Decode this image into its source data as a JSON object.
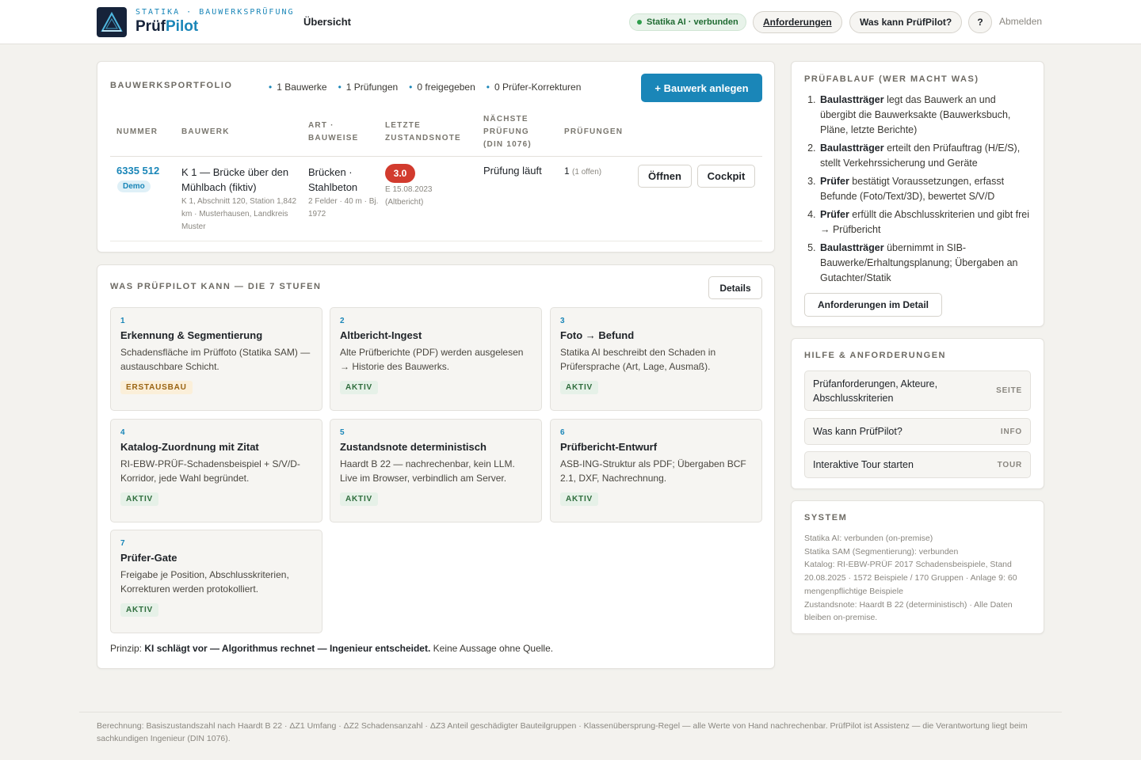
{
  "header": {
    "brand_sub": "STATIKA · BAUWERKSPRÜFUNG",
    "brand_name_a": "Prüf",
    "brand_name_b": "Pilot",
    "nav_overview": "Übersicht",
    "status": "Statika AI · verbunden",
    "requirements": "Anforderungen",
    "what_can": "Was kann PrüfPilot?",
    "help": "?",
    "logout": "Abmelden"
  },
  "portfolio": {
    "title": "Bauwerksportfolio",
    "stats": [
      "1 Bauwerke",
      "1 Prüfungen",
      "0 freigegeben",
      "0 Prüfer-Korrekturen"
    ],
    "add_button": "+ Bauwerk anlegen",
    "headers": {
      "nummer": "NUMMER",
      "bauwerk": "BAUWERK",
      "art_1": "ART ·",
      "art_2": "BAUWEISE",
      "note_1": "LETZTE",
      "note_2": "ZUSTANDSNOTE",
      "next_1": "NÄCHSTE",
      "next_2": "PRÜFUNG",
      "next_3": "(DIN 1076)",
      "pruef": "PRÜFUNGEN"
    },
    "row": {
      "number": "6335 512",
      "demo": "Demo",
      "name": "K 1 — Brücke über den Mühlbach (fiktiv)",
      "meta": "K 1, Abschnitt 120, Station 1,842 km · Musterhausen, Landkreis Muster",
      "art": "Brücken · Stahlbeton",
      "art_meta": "2 Felder · 40 m · Bj. 1972",
      "note": "3.0",
      "note_date": "E 15.08.2023",
      "note_src": "(Altbericht)",
      "next": "Prüfung läuft",
      "count": "1",
      "count_sub": "(1 offen)",
      "open": "Öffnen",
      "cockpit": "Cockpit"
    }
  },
  "stages": {
    "title": "Was PrüfPilot kann — die 7 Stufen",
    "details": "Details",
    "items": [
      {
        "n": "1",
        "title": "Erkennung & Segmentierung",
        "desc": "Schadensfläche im Prüffoto (Statika SAM) — austauschbare Schicht.",
        "badge": "ERSTAUSBAU"
      },
      {
        "n": "2",
        "title": "Altbericht-Ingest",
        "desc": "Alte Prüfberichte (PDF) werden ausgelesen → Historie des Bauwerks.",
        "badge": "AKTIV"
      },
      {
        "n": "3",
        "title": "Foto → Befund",
        "desc": "Statika AI beschreibt den Schaden in Prüfersprache (Art, Lage, Ausmaß).",
        "badge": "AKTIV"
      },
      {
        "n": "4",
        "title": "Katalog-Zuordnung mit Zitat",
        "desc": "RI-EBW-PRÜF-Schadensbeispiel + S/V/D-Korridor, jede Wahl begründet.",
        "badge": "AKTIV"
      },
      {
        "n": "5",
        "title": "Zustandsnote deterministisch",
        "desc": "Haardt B 22 — nachrechenbar, kein LLM. Live im Browser, verbindlich am Server.",
        "badge": "AKTIV"
      },
      {
        "n": "6",
        "title": "Prüfbericht-Entwurf",
        "desc": "ASB-ING-Struktur als PDF; Übergaben BCF 2.1, DXF, Nachrechnung.",
        "badge": "AKTIV"
      },
      {
        "n": "7",
        "title": "Prüfer-Gate",
        "desc": "Freigabe je Position, Abschlusskriterien, Korrekturen werden protokolliert.",
        "badge": "AKTIV"
      }
    ],
    "principle_lead": "Prinzip: ",
    "principle_bold": "KI schlägt vor — Algorithmus rechnet — Ingenieur entscheidet.",
    "principle_tail": " Keine Aussage ohne Quelle."
  },
  "flow": {
    "title": "Prüfablauf (wer macht was)",
    "steps": [
      {
        "who": "Baulastträger",
        "text": " legt das Bauwerk an und übergibt die Bauwerksakte (Bauwerksbuch, Pläne, letzte Berichte)"
      },
      {
        "who": "Baulastträger",
        "text": " erteilt den Prüfauftrag (H/E/S), stellt Verkehrssicherung und Geräte"
      },
      {
        "who": "Prüfer",
        "text": " bestätigt Voraussetzungen, erfasst Befunde (Foto/Text/3D), bewertet S/V/D"
      },
      {
        "who": "Prüfer",
        "text": " erfüllt die Abschlusskriterien und gibt frei → Prüfbericht"
      },
      {
        "who": "Baulastträger",
        "text": " übernimmt in SIB-Bauwerke/Erhaltungsplanung; Übergaben an Gutachter/Statik"
      }
    ],
    "button": "Anforderungen im Detail"
  },
  "help": {
    "title": "Hilfe & Anforderungen",
    "items": [
      {
        "label": "Prüfanforderungen, Akteure, Abschlusskriterien",
        "kind": "SEITE"
      },
      {
        "label": "Was kann PrüfPilot?",
        "kind": "INFO"
      },
      {
        "label": "Interaktive Tour starten",
        "kind": "TOUR"
      }
    ]
  },
  "system": {
    "title": "System",
    "lines": [
      "Statika AI: verbunden (on-premise)",
      "Statika SAM (Segmentierung): verbunden",
      "Katalog: RI-EBW-PRÜF 2017 Schadensbeispiele, Stand 20.08.2025 · 1572 Beispiele / 170 Gruppen · Anlage 9: 60 mengenpflichtige Beispiele",
      "Zustandsnote: Haardt B 22 (deterministisch) · Alle Daten bleiben on-premise."
    ]
  },
  "footer": "Berechnung: Basiszustandszahl nach Haardt B 22 · ΔZ1 Umfang · ΔZ2 Schadensanzahl · ΔZ3 Anteil geschädigter Bauteilgruppen · Klassenübersprung-Regel — alle Werte von Hand nachrechenbar. PrüfPilot ist Assistenz — die Verantwortung liegt beim sachkundigen Ingenieur (DIN 1076).",
  "colors": {
    "accent": "#1a86b8",
    "navy": "#16233a",
    "danger": "#d23b2e",
    "ok": "#2e9e4c"
  },
  "icons": {
    "logo": "triangle-logo-icon",
    "status": "status-dot-icon"
  }
}
